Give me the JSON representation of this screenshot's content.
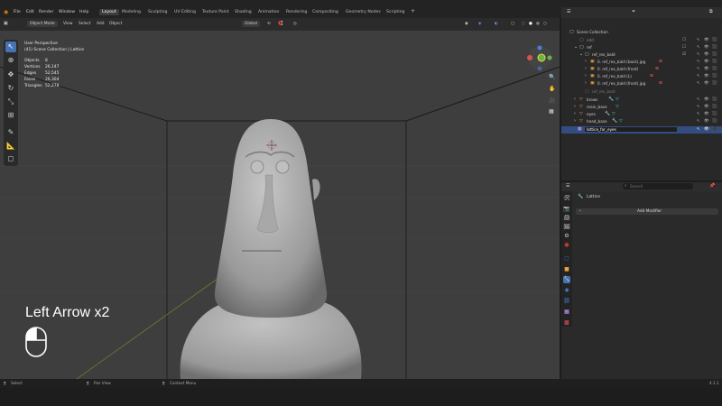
{
  "menus": [
    "File",
    "Edit",
    "Render",
    "Window",
    "Help"
  ],
  "workspaces": [
    {
      "label": "Layout",
      "active": true
    },
    {
      "label": "Modeling",
      "active": false
    },
    {
      "label": "Sculpting",
      "active": false
    },
    {
      "label": "UV Editing",
      "active": false
    },
    {
      "label": "Texture Paint",
      "active": false
    },
    {
      "label": "Shading",
      "active": false
    },
    {
      "label": "Animation",
      "active": false
    },
    {
      "label": "Rendering",
      "active": false
    },
    {
      "label": "Compositing",
      "active": false
    },
    {
      "label": "Geometry Nodes",
      "active": false
    },
    {
      "label": "Scripting",
      "active": false
    }
  ],
  "add_tab": "+",
  "scene": "Scene",
  "view_layer": "ViewLayer",
  "viewport_header": {
    "mode": "Object Mode",
    "view": "View",
    "select": "Select",
    "add": "Add",
    "object": "Object",
    "orientation": "Global",
    "options": "Options"
  },
  "overlay": {
    "perspective": "User Perspective",
    "collection": "(41) Scene Collection | Lattice",
    "stats": [
      {
        "label": "Objects",
        "value": "8"
      },
      {
        "label": "Vertices",
        "value": "26,147"
      },
      {
        "label": "Edges",
        "value": "52,545"
      },
      {
        "label": "Faces",
        "value": "26,304"
      },
      {
        "label": "Triangles",
        "value": "52,278"
      }
    ]
  },
  "caption": "Left Arrow x2",
  "outliner": {
    "root": "Scene Collection",
    "rows": [
      {
        "label": "add",
        "indent": 0
      },
      {
        "label": "ref",
        "indent": 0
      },
      {
        "label": "ref_rex_bald",
        "indent": 1
      },
      {
        "label": "0. ref_rex_bald (back).jpg",
        "indent": 2
      },
      {
        "label": "0. ref_rex_bald (front)",
        "indent": 2
      },
      {
        "label": "0. ref_rex_bald (L)",
        "indent": 2
      },
      {
        "label": "0. ref_rex_bald (front).jpg",
        "indent": 2
      },
      {
        "label": "ref_rex_bald",
        "indent": 1
      },
      {
        "label": "brows",
        "indent": 0
      },
      {
        "label": "main_base",
        "indent": 0
      },
      {
        "label": "eyes",
        "indent": 0
      },
      {
        "label": "head_base",
        "indent": 0
      },
      {
        "label": "lattice_for_eyes",
        "indent": 0
      }
    ]
  },
  "properties": {
    "search_placeholder": "Search",
    "object_name": "Lattice",
    "add_modifier": "Add Modifier"
  },
  "status_bar": {
    "select": "Select",
    "pan_view": "Pan View",
    "context_menu": "Context Menu",
    "version": "4.1.1"
  },
  "colors": {
    "accent": "#4772b3",
    "viewport_bg": "#3e3e3e",
    "header_bg": "#2b2b2b",
    "selected_row": "#334d80"
  }
}
